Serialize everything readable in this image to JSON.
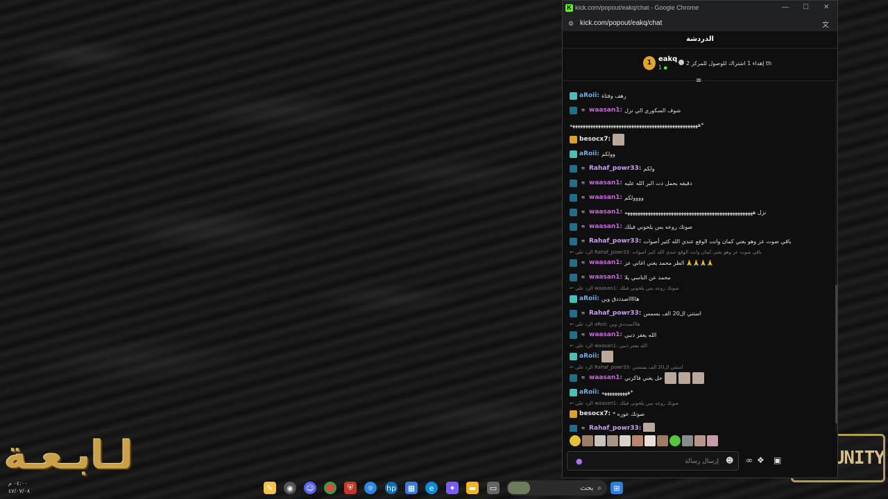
{
  "window": {
    "title": "kick.com/popout/eakq/chat - Google Chrome",
    "url": "kick.com/popout/eakq/chat"
  },
  "chat": {
    "header": "الدردشة",
    "pinned": {
      "rank": "1",
      "user": "eakq",
      "count": "1",
      "text": "إهداء 1 اشتراك للوصول للمركز 2 th"
    },
    "messages": [
      {
        "user": "aRoii",
        "badge": "teal",
        "text": "رهف وفتاة",
        "color": "u-aroii",
        "sub": false,
        "emotes": 0
      },
      {
        "user": "waasan1",
        "badge": "blue",
        "text": "شوف السكوري الي نزل",
        "color": "u-waasan",
        "sub": true,
        "emotes": 0
      },
      {
        "user": "",
        "badge": "",
        "text": "ههههههههههههههههههههههههههههههههههههههههههههههههههه*",
        "color": "",
        "sub": false,
        "emotes": 0
      },
      {
        "user": "besocx7",
        "badge": "gold",
        "text": "",
        "color": "u-besocx",
        "sub": false,
        "emotes": 1
      },
      {
        "user": "aRoii",
        "badge": "teal",
        "text": "وولكم",
        "color": "u-aroii",
        "sub": false,
        "emotes": 0
      },
      {
        "user": "Rahaf_powr33",
        "badge": "blue",
        "text": "ولكم",
        "color": "u-rahaf",
        "sub": true,
        "emotes": 0
      },
      {
        "user": "waasan1",
        "badge": "blue",
        "text": "دقيقه يحمل ذت البر الله عليه",
        "color": "u-waasan",
        "sub": true,
        "emotes": 0
      },
      {
        "user": "waasan1",
        "badge": "blue",
        "text": "وووولكم",
        "color": "u-waasan",
        "sub": true,
        "emotes": 0
      },
      {
        "user": "waasan1",
        "badge": "blue",
        "text": "نزل ههههههههههههههههههههههههههههههههههههههههههههههههههه",
        "color": "u-waasan",
        "sub": true,
        "emotes": 0
      },
      {
        "user": "waasan1",
        "badge": "blue",
        "text": "صوتك روعه بس يلحوني فيلك",
        "color": "u-waasan",
        "sub": true,
        "emotes": 0
      },
      {
        "user": "Rahaf_powr33",
        "badge": "blue",
        "text": "باقي صوت عز وهو يغني كمان وانت الوقع عندي الله كثير أصوات",
        "color": "u-rahaf",
        "sub": true,
        "emotes": 0
      },
      {
        "reply": "الرد على Rahaf_powr33: باقي صوت عز وهو يغني كمان وانت الوقع عندي الله كثير أصوات"
      },
      {
        "user": "waasan1",
        "badge": "blue",
        "text": "الطر محمد يغني اغاني عز 🙏🙏🙏🙏",
        "color": "u-waasan",
        "sub": true,
        "emotes": 0
      },
      {
        "user": "waasan1",
        "badge": "blue",
        "text": "محمد عن الناسي يلا",
        "color": "u-waasan",
        "sub": true,
        "emotes": 0
      },
      {
        "reply": "الرد على waasan1: صوتك روعه بس يلحوني فيلك"
      },
      {
        "user": "aRoii",
        "badge": "teal",
        "text": "هاااااصدددق وين",
        "color": "u-aroii",
        "sub": false,
        "emotes": 0
      },
      {
        "user": "Rahaf_powr33",
        "badge": "blue",
        "text": "استني ال20 الف يسمس",
        "color": "u-rahaf",
        "sub": true,
        "emotes": 0
      },
      {
        "reply": "الرد على aRoii: هاااصدددق وين"
      },
      {
        "user": "waasan1",
        "badge": "blue",
        "text": "الله يغفر ذنبي",
        "color": "u-waasan",
        "sub": true,
        "emotes": 0
      },
      {
        "reply": "الرد على waasan1: الله يغفر ذنبي"
      },
      {
        "user": "aRoii",
        "badge": "teal",
        "text": "",
        "color": "u-aroii",
        "sub": false,
        "emotes": 1
      },
      {
        "reply": "الرد على Rahaf_powr33: استني ال20 الف يسمس"
      },
      {
        "user": "waasan1",
        "badge": "blue",
        "text": "حل يغني فاكرني",
        "color": "u-waasan",
        "sub": true,
        "emotes": 3
      },
      {
        "user": "aRoii",
        "badge": "teal",
        "text": "ههههههههههه*",
        "color": "u-aroii",
        "sub": false,
        "emotes": 0
      },
      {
        "reply": "الرد على waasan1: صوتك روعه بس يلحوني فيلك"
      },
      {
        "user": "besocx7",
        "badge": "gold",
        "text": "* صوتك عوره",
        "color": "u-besocx",
        "sub": false,
        "emotes": 0
      },
      {
        "user": "Rahaf_powr33",
        "badge": "blue",
        "text": "",
        "color": "u-rahaf",
        "sub": true,
        "emotes": 1
      }
    ],
    "input_placeholder": "إرسال رسالة"
  },
  "taskbar": {
    "search_label": "بحث"
  },
  "desktop": {
    "clock_time": "٠٤:٠٠ م",
    "clock_date": "٤٧/٠٧/٠٨",
    "community_logo": "COMMUNITY"
  },
  "colors": {
    "kick_green": "#53fc18",
    "window_bg": "#0f0f0f"
  }
}
